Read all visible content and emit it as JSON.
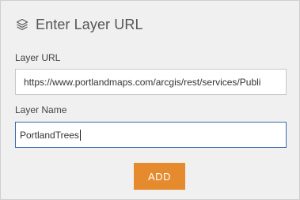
{
  "header": {
    "icon": "layers-icon",
    "title": "Enter Layer URL"
  },
  "form": {
    "url_label": "Layer URL",
    "url_value": "https://www.portlandmaps.com/arcgis/rest/services/Publi",
    "name_label": "Layer Name",
    "name_value": "PortlandTrees"
  },
  "actions": {
    "add_label": "ADD"
  },
  "colors": {
    "accent": "#e68a2e",
    "focus_border": "#3b6bab",
    "panel_bg": "#f0f0f0"
  }
}
